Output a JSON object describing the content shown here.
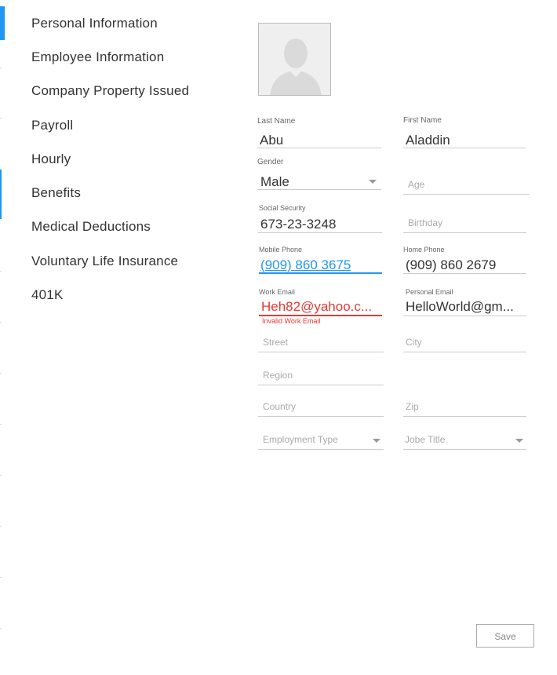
{
  "sidebar": {
    "items": [
      {
        "label": "Personal Information"
      },
      {
        "label": "Employee Information"
      },
      {
        "label": "Company Property Issued"
      },
      {
        "label": "Payroll"
      },
      {
        "label": "Hourly"
      },
      {
        "label": "Benefits"
      },
      {
        "label": "Medical Deductions"
      },
      {
        "label": "Voluntary Life Insurance"
      },
      {
        "label": "401K"
      }
    ]
  },
  "profile": {
    "avatar_icon": "user-silhouette-icon"
  },
  "form": {
    "last_name": {
      "label": "Last Name",
      "value": "Abu"
    },
    "first_name": {
      "label": "First Name",
      "value": "Aladdin"
    },
    "gender": {
      "label": "Gender",
      "value": "Male"
    },
    "age": {
      "placeholder": "Age"
    },
    "social_security": {
      "label": "Social Security",
      "value": "673-23-3248"
    },
    "birthday": {
      "placeholder": "Birthday"
    },
    "mobile_phone": {
      "label": "Mobile Phone",
      "value": "(909) 860 3675"
    },
    "home_phone": {
      "label": "Home Phone",
      "value": "(909) 860 2679"
    },
    "work_email": {
      "label": "Work Email",
      "value": "Heh82@yahoo.c...",
      "error": "Invalid Work Email"
    },
    "personal_email": {
      "label": "Personal Email",
      "value": "HelloWorld@gm..."
    },
    "street": {
      "placeholder": "Street"
    },
    "city": {
      "placeholder": "City"
    },
    "region": {
      "placeholder": "Region"
    },
    "country": {
      "placeholder": "Country"
    },
    "zip": {
      "placeholder": "Zip"
    },
    "employment_type": {
      "placeholder": "Employment Type"
    },
    "job_title": {
      "placeholder": "Jobe Title"
    }
  },
  "actions": {
    "save_label": "Save"
  },
  "colors": {
    "accent": "#2196f3",
    "error": "#e53935"
  }
}
